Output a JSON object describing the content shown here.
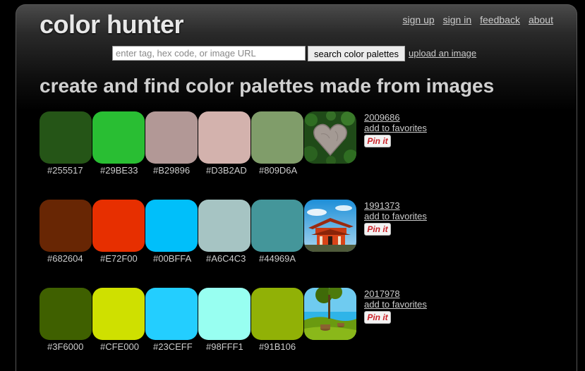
{
  "header": {
    "logo": "color hunter",
    "nav": [
      {
        "label": "sign up"
      },
      {
        "label": "sign in"
      },
      {
        "label": "feedback"
      },
      {
        "label": "about"
      }
    ]
  },
  "search": {
    "placeholder": "enter tag, hex code, or image URL",
    "value": "",
    "button_label": "search color palettes",
    "upload_label": "upload an image"
  },
  "headline": "create and find color palettes made from images",
  "palettes": [
    {
      "id": "2009686",
      "favorite_label": "add to favorites",
      "pin_label": "Pin it",
      "image": "heart-shaped-stone-on-ivy",
      "colors": [
        "#255517",
        "#29BE33",
        "#B29896",
        "#D3B2AD",
        "#809D6A"
      ]
    },
    {
      "id": "1991373",
      "favorite_label": "add to favorites",
      "pin_label": "Pin it",
      "image": "red-shrine-under-blue-sky",
      "colors": [
        "#682604",
        "#E72F00",
        "#00BFFA",
        "#A6C4C3",
        "#44969A"
      ]
    },
    {
      "id": "2017978",
      "favorite_label": "add to favorites",
      "pin_label": "Pin it",
      "image": "tree-stumps-on-green-island",
      "colors": [
        "#3F6000",
        "#CFE000",
        "#23CEFF",
        "#98FFF1",
        "#91B106"
      ]
    }
  ]
}
